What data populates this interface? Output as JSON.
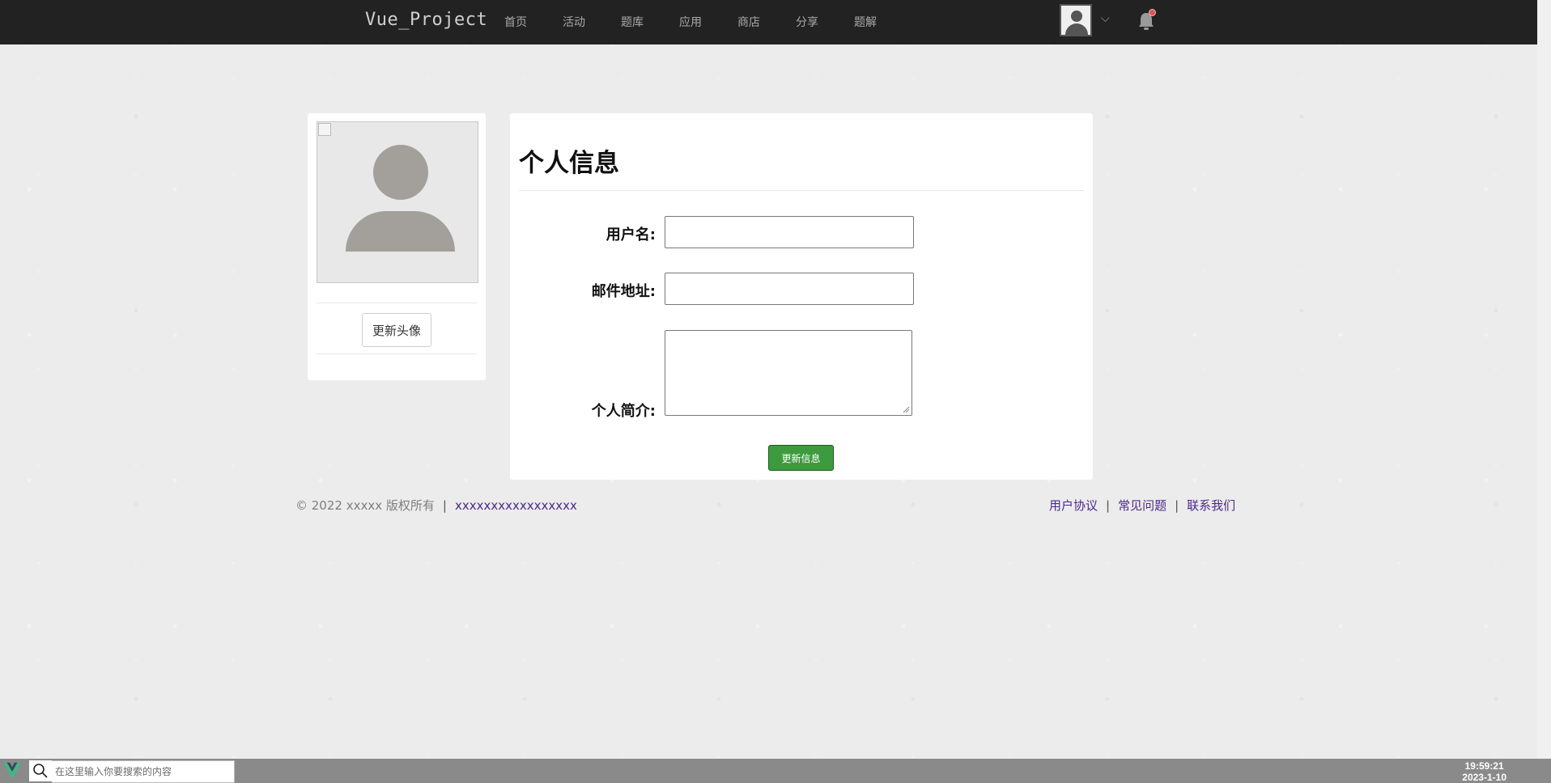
{
  "header": {
    "brand": "Vue_Project",
    "nav": [
      "首页",
      "活动",
      "题库",
      "应用",
      "商店",
      "分享",
      "题解"
    ],
    "user_menu_caret": "⌵",
    "notification_color": "#e05353"
  },
  "profile_card": {
    "update_avatar_label": "更新头像"
  },
  "info_panel": {
    "title": "个人信息",
    "username_label": "用户名:",
    "username_value": "",
    "email_label": "邮件地址:",
    "email_value": "",
    "bio_label": "个人简介:",
    "bio_value": "",
    "submit_label": "更新信息",
    "submit_color": "#3e9a3e"
  },
  "footer": {
    "copyright": "© 2022 xxxxx 版权所有",
    "left_sep": "|",
    "site_link": "xxxxxxxxxxxxxxxxx",
    "links": [
      "用户协议",
      "常见问题",
      "联系我们"
    ],
    "sep": "|"
  },
  "taskbar": {
    "search_placeholder": "在这里输入你要搜索的内容",
    "time": "19:59:21",
    "date": "2023-1-10",
    "logo_color": "#41b883"
  }
}
